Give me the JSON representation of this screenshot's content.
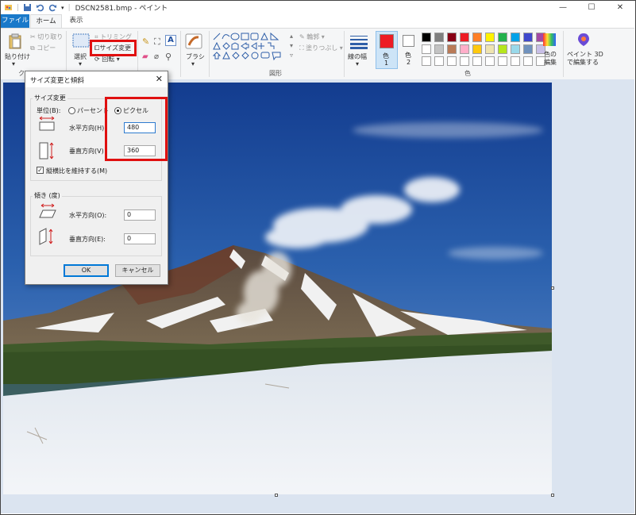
{
  "window": {
    "title": "DSCN2581.bmp - ペイント",
    "controls": {
      "minimize": "—",
      "maximize": "☐",
      "close": "✕"
    }
  },
  "tabs": {
    "file": "ファイル",
    "home": "ホーム",
    "view": "表示"
  },
  "ribbon": {
    "clipboard": {
      "paste": "貼り付け",
      "cut": "切り取り",
      "copy": "コピー",
      "group_label": "ク"
    },
    "image": {
      "select": "選択",
      "crop": "トリミング",
      "resize": "サイズ変更",
      "rotate": "回転"
    },
    "brushes": "ブラシ",
    "shapes": {
      "outline": "輪郭",
      "fill": "塗りつぶし",
      "group_label": "図形"
    },
    "size": "線の幅",
    "color1": {
      "label": "色",
      "sub": "1"
    },
    "color2": {
      "label": "色",
      "sub": "2"
    },
    "colors_group_label": "色",
    "edit_colors": {
      "line1": "色の",
      "line2": "編集"
    },
    "paint3d": {
      "line1": "ペイント 3D",
      "line2": "で編集する"
    },
    "palette_row1": [
      "#000000",
      "#7f7f7f",
      "#880015",
      "#ed1c24",
      "#ff7f27",
      "#fff200",
      "#22b14c",
      "#00a2e8",
      "#3f48cc",
      "#a349a4"
    ],
    "palette_row2": [
      "#ffffff",
      "#c3c3c3",
      "#b97a57",
      "#ffaec9",
      "#ffc90e",
      "#efe4b0",
      "#b5e61d",
      "#99d9ea",
      "#7092be",
      "#c8bfe7"
    ],
    "color1_value": "#ed1c24",
    "color2_value": "#ffffff"
  },
  "dialog": {
    "title": "サイズ変更と傾斜",
    "resize_legend": "サイズ変更",
    "unit_label": "単位(B):",
    "percent": "パーセント",
    "pixels": "ピクセル",
    "horizontal": "水平方向(H)",
    "vertical": "垂直方向(V)",
    "width": "480",
    "height": "360",
    "keep_ratio": "縦横比を維持する(M)",
    "skew_legend": "傾き (度)",
    "skew_h_label": "水平方向(O):",
    "skew_v_label": "垂直方向(E):",
    "skew_h": "0",
    "skew_v": "0",
    "ok": "OK",
    "cancel": "キャンセル"
  },
  "highlight_color": "#e01010"
}
